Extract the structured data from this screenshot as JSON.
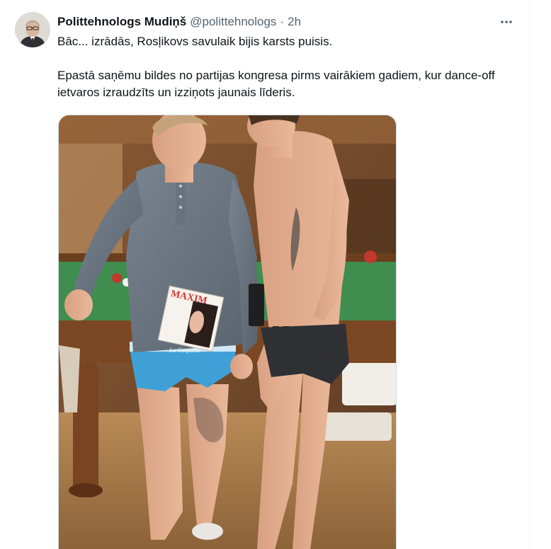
{
  "tweet": {
    "author": {
      "display_name": "Polittehnologs Mudiņš",
      "handle": "@polittehnologs",
      "avatar_icon": "profile-photo-avatar"
    },
    "separator": "·",
    "timestamp": "2h",
    "more_icon": "more-horizontal-icon",
    "text": {
      "line1": "Bāc... izrādās, Rosļikovs savulaik bijis karsts puisis.",
      "line2": "Epastā saņēmu bildes no partijas kongresa pirms vairākiem gadiem, kur dance-off ietvaros izraudzīts un izziņots jaunais līderis."
    },
    "media": {
      "magazine_title": "MAXIM",
      "underwear_brand": "La Coquette"
    }
  },
  "colors": {
    "text_primary": "#0f1419",
    "text_secondary": "#536471",
    "border": "#cfd9de",
    "billiard_cloth": "#3f8d4f",
    "wood_wall": "#7a5232"
  }
}
